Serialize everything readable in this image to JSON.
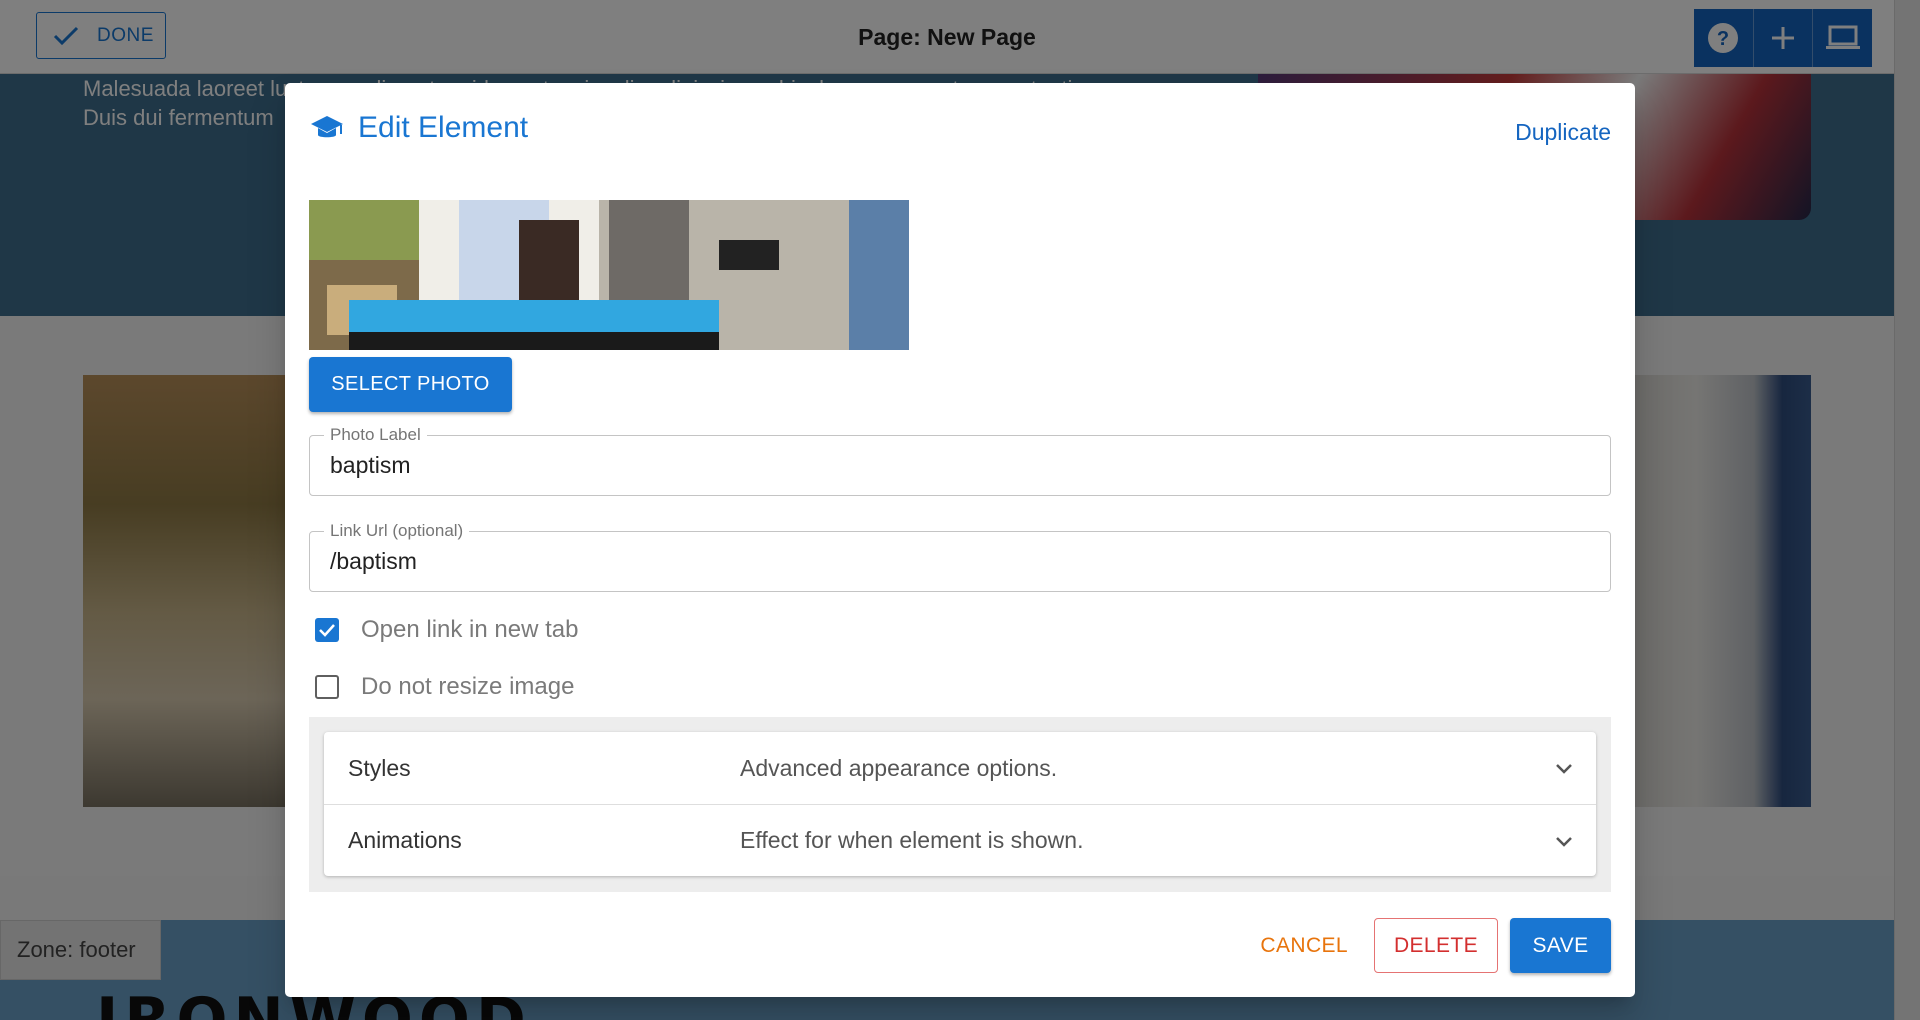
{
  "editor": {
    "done_label": "DONE",
    "page_title": "Page: New Page",
    "toolbar_icons": [
      "help-icon",
      "plus-icon",
      "laptop-icon"
    ],
    "hero_text_line1": "Malesuada laoreet luctus condimentum id egestas, iaculis adipiscing vehicula congue porta ac potenti.",
    "hero_text_line2": "Duis dui fermentum",
    "zone_label": "Zone: footer",
    "footer_logo_text": "IRONWOOD"
  },
  "modal": {
    "title": "Edit Element",
    "title_icon": "graduation-cap-icon",
    "duplicate_label": "Duplicate",
    "select_photo_label": "SELECT PHOTO",
    "photo_label": {
      "legend": "Photo Label",
      "value": "baptism"
    },
    "link_url": {
      "legend": "Link Url (optional)",
      "value": "/baptism"
    },
    "open_new_tab": {
      "label": "Open link in new tab",
      "checked": true
    },
    "no_resize": {
      "label": "Do not resize image",
      "checked": false
    },
    "accordion": [
      {
        "title": "Styles",
        "description": "Advanced appearance options."
      },
      {
        "title": "Animations",
        "description": "Effect for when element is shown."
      }
    ],
    "actions": {
      "cancel": "CANCEL",
      "delete": "DELETE",
      "save": "SAVE"
    }
  },
  "colors": {
    "primary": "#1976d2",
    "cancel": "#e8740c",
    "delete": "#d32f2f",
    "hero": "#3f6f8f",
    "footer": "#6aa0c8"
  }
}
